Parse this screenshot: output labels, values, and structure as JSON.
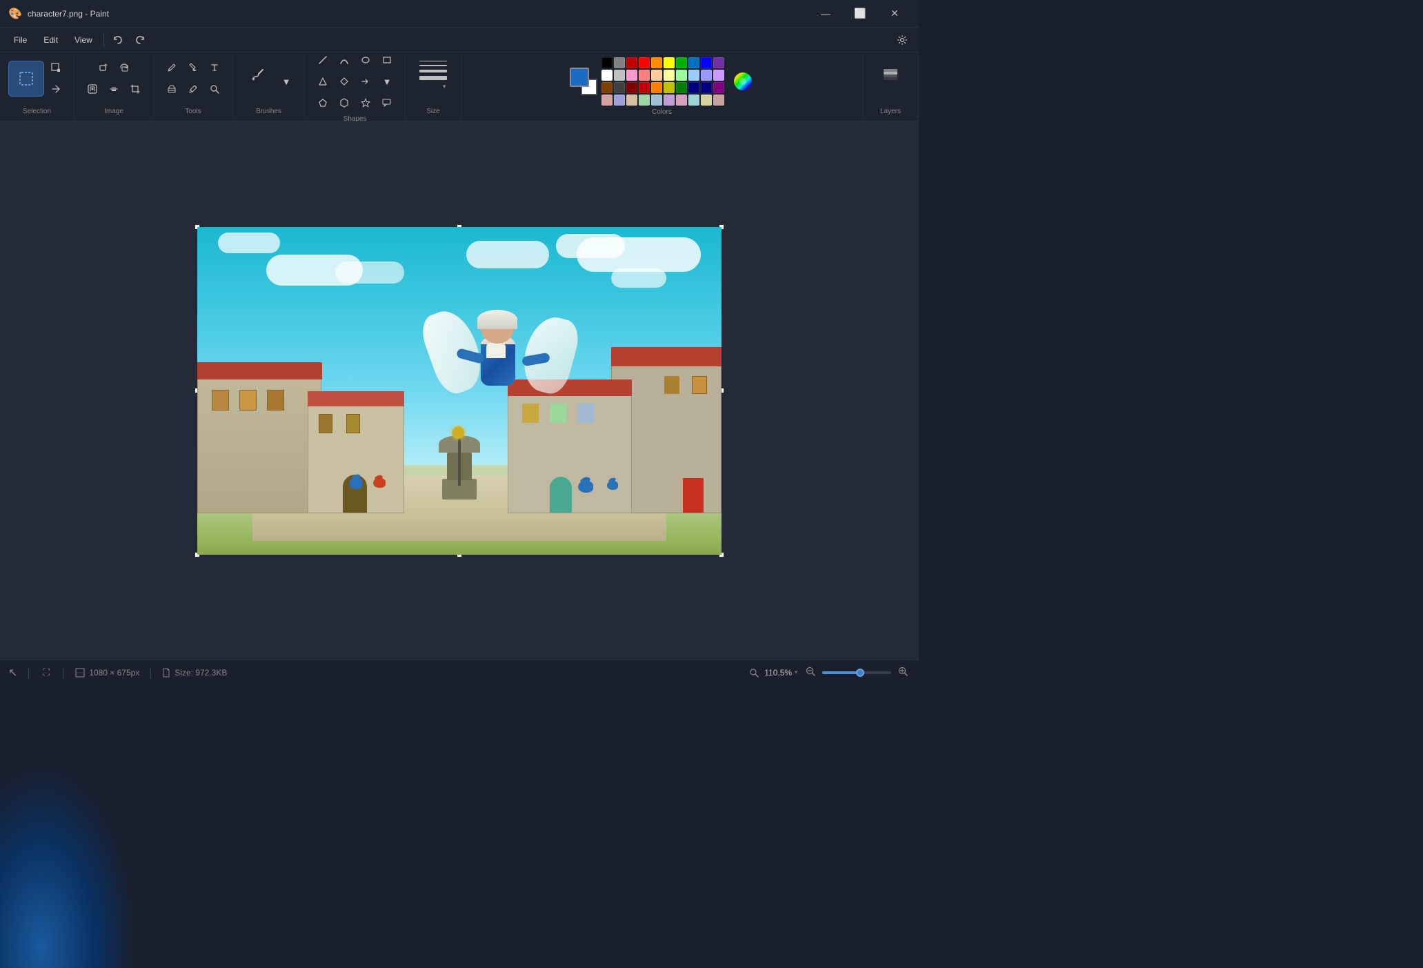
{
  "window": {
    "title": "character7.png - Paint",
    "icon": "🎨"
  },
  "title_bar": {
    "title": "character7.png - Paint",
    "minimize": "—",
    "maximize": "⬜",
    "close": "✕"
  },
  "menu": {
    "file": "File",
    "edit": "Edit",
    "view": "View",
    "undo_tooltip": "Undo",
    "redo_tooltip": "Redo",
    "settings_tooltip": "Settings"
  },
  "toolbar": {
    "groups": {
      "selection": {
        "label": "Selection",
        "main_tool": "selection"
      },
      "image": {
        "label": "Image",
        "tools": [
          "resize",
          "rotate",
          "crop"
        ]
      },
      "tools": {
        "label": "Tools",
        "tools": [
          "pencil",
          "fill",
          "text",
          "eraser",
          "color-picker",
          "magnifier"
        ]
      },
      "brushes": {
        "label": "Brushes",
        "tools": [
          "brush"
        ]
      },
      "shapes": {
        "label": "Shapes",
        "tools": [
          "line",
          "curve",
          "ellipse",
          "rectangle",
          "triangle",
          "rhombus",
          "pentagon",
          "hexagon",
          "arrow"
        ]
      },
      "size": {
        "label": "Size",
        "lines": [
          1,
          3,
          5,
          8
        ]
      },
      "colors": {
        "label": "Colors",
        "color1": "#1a6bc4",
        "color2": "#ffffff",
        "swatches_row1": [
          "#000000",
          "#808080",
          "#c00000",
          "#ff0000",
          "#ff8c00",
          "#ffff00",
          "#00b000",
          "#0070c0",
          "#0000ff",
          "#7030a0"
        ],
        "swatches_row2": [
          "#ffffff",
          "#c0c0c0",
          "#ff99cc",
          "#ff7f7f",
          "#ffcc99",
          "#ffff99",
          "#99ff99",
          "#99ccff",
          "#9999ff",
          "#cc99ff"
        ],
        "swatches_row3": [
          "#7f3f00",
          "#3f3f3f",
          "#800000",
          "#c00000",
          "#ff7f00",
          "#c0c000",
          "#007f00",
          "#00007f",
          "#00007f",
          "#7f007f"
        ],
        "swatches_row4": [
          "#d4a0a0",
          "#a0a0d4",
          "#d4c0a0",
          "#a0d4a0",
          "#a0c0d4",
          "#c0a0d4",
          "#d4a0c0",
          "#a0d4d4",
          "#d4d4a0",
          "#c8a0a0"
        ]
      },
      "layers": {
        "label": "Layers"
      }
    }
  },
  "status_bar": {
    "dimensions": "1080 × 675px",
    "file_size_label": "Size: 972.3KB",
    "zoom_percent": "110.5%",
    "zoom_value": 110.5
  },
  "canvas": {
    "image_alt": "Character flying in a town square with birds and feathers"
  }
}
